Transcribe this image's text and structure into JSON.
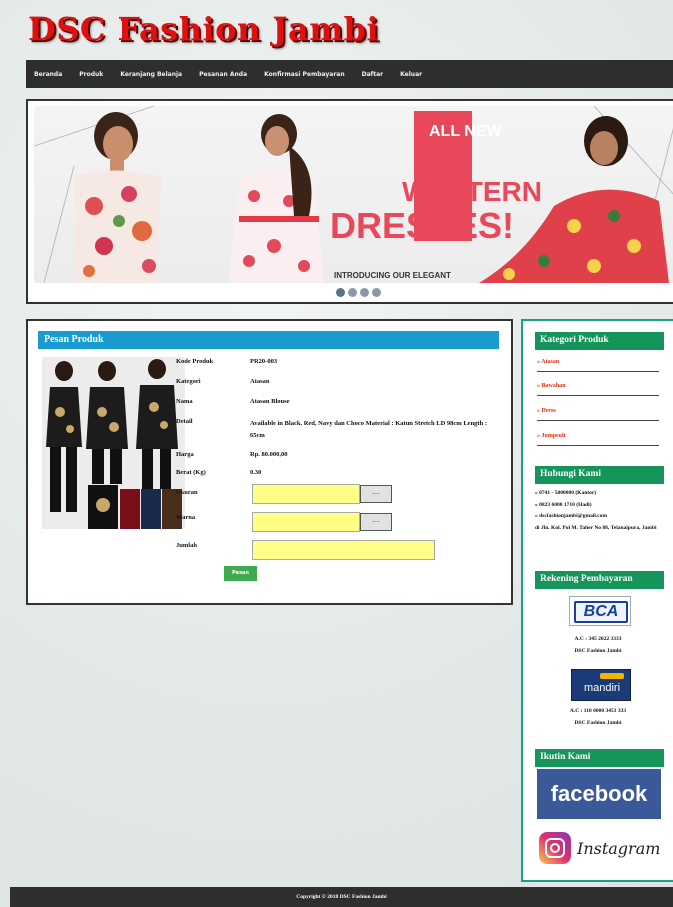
{
  "site": {
    "title": "DSC Fashion Jambi"
  },
  "nav": [
    "Beranda",
    "Produk",
    "Keranjang Belanja",
    "Pesanan Anda",
    "Konfirmasi Pembayaran",
    "Daftar",
    "Keluar"
  ],
  "banner": {
    "line1": "ALL NEW",
    "line2": "WESTERN",
    "line3": "DRESSES!",
    "line4": "INTRODUCING OUR ELEGANT",
    "dots": 4
  },
  "product_panel": {
    "heading": "Pesan Produk",
    "labels": {
      "kode": "Kode Produk",
      "kategori": "Kategori",
      "nama": "Nama",
      "detail": "Detail",
      "harga": "Harga",
      "berat": "Berat (Kg)",
      "ukuran": "Ukuran",
      "warna": "Warna",
      "jumlah": "Jumlah"
    },
    "values": {
      "kode": "PR20-003",
      "kategori": "Atasan",
      "nama": "Atasan Blouse",
      "detail": "Available in Black, Red, Navy dan Choco Material : Katun Stretch LD 98cm Length : 65cm",
      "harga": "Rp. 80.000,00",
      "berat": "0.30"
    },
    "select_btn": "...",
    "order_btn": "Pesan"
  },
  "sidebar": {
    "category_heading": "Kategori Produk",
    "categories": [
      "» Atasan",
      "» Bawahan",
      "» Dress",
      "» Jumpsuit"
    ],
    "contact_heading": "Hubungi Kami",
    "contacts": [
      "» 0741 - 5000000 (Kantor)",
      "» 0823 6000 1710 (Hadi)",
      "» dscfashionjambi@gmail.com",
      "di Jln. Kol. Pol M. Taher No 88, Telanaipura, Jambi"
    ],
    "bank_heading": "Rekening Pembayaran",
    "banks": [
      {
        "logo": "BCA",
        "account": "A.C : 345 2022 3333",
        "owner": "DSC Fashion Jambi"
      },
      {
        "logo": "mandiri",
        "account": "A.C : 110 0000 3451 333",
        "owner": "DSC Fashion Jambi"
      }
    ],
    "follow_heading": "Ikutin Kami",
    "facebook": "facebook",
    "instagram": "Instagram"
  },
  "footer": {
    "text": "Copyright © 2018 DSC Fashion Jambi"
  }
}
